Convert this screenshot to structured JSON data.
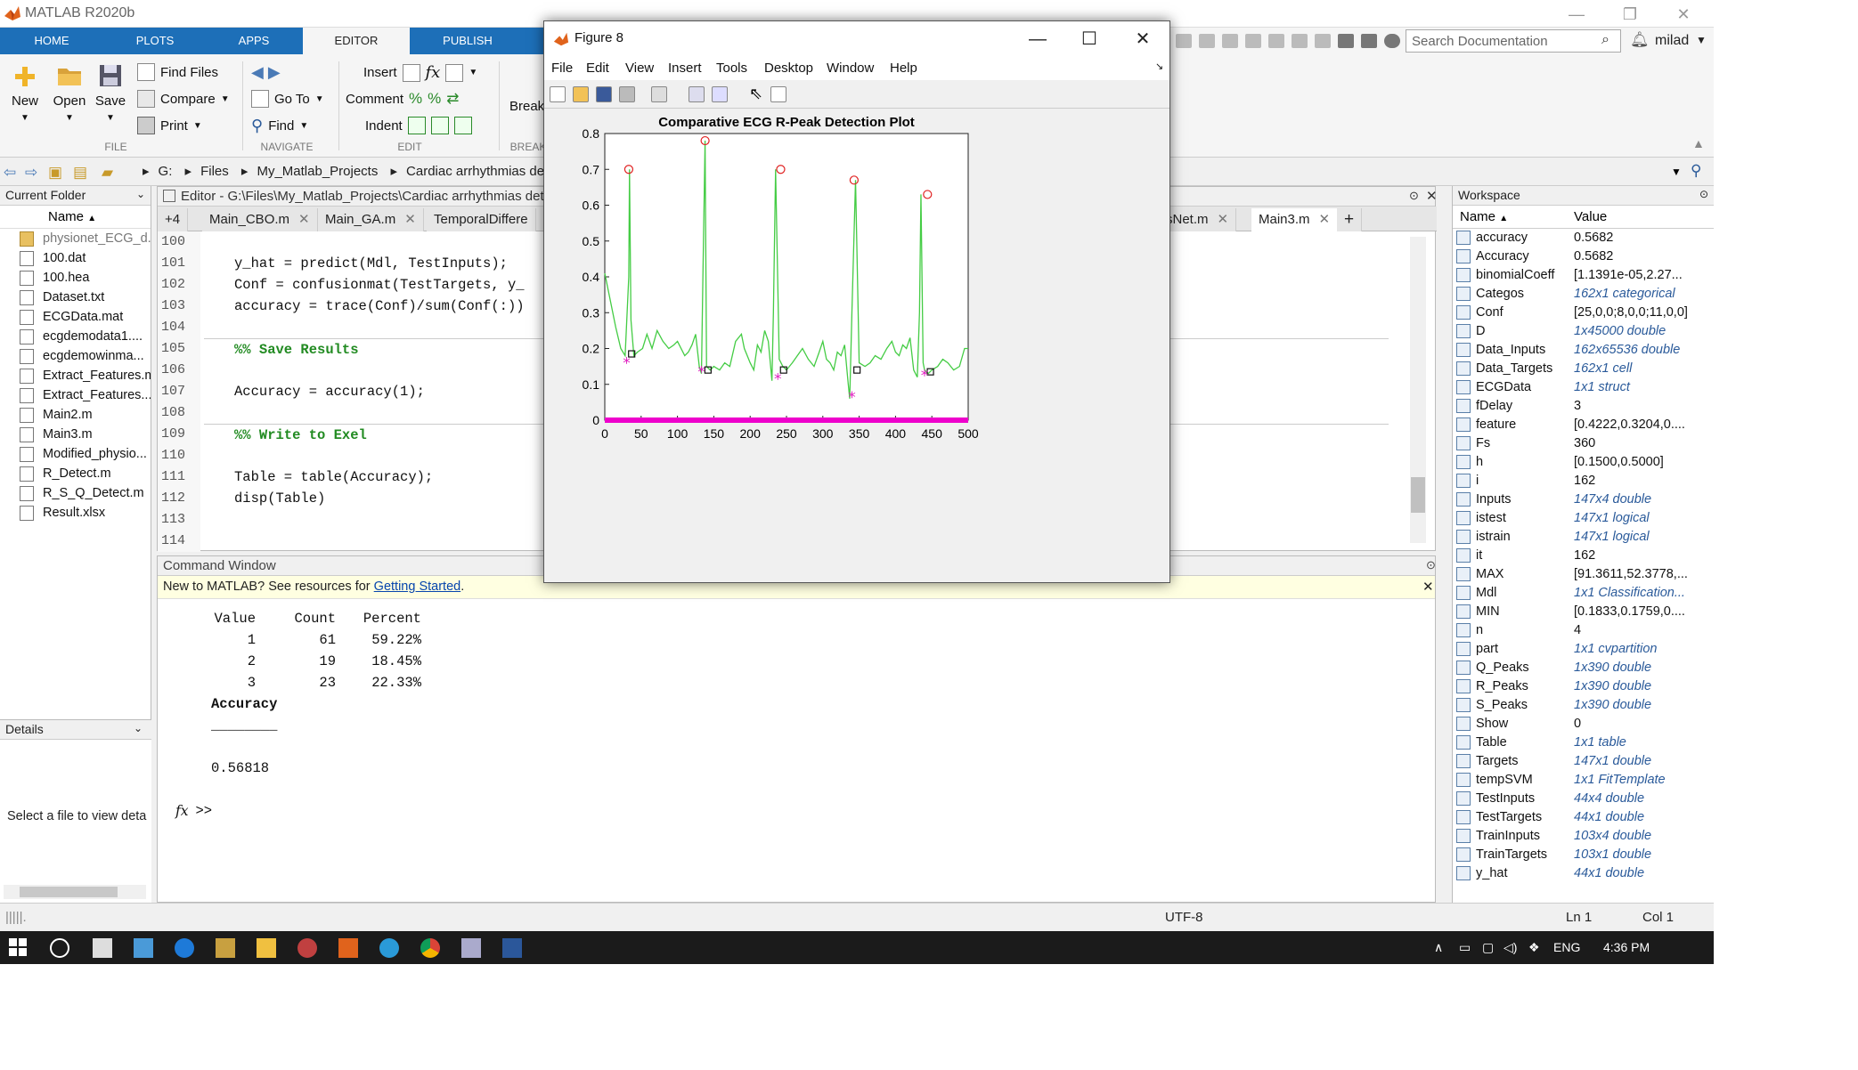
{
  "app": {
    "title": "MATLAB R2020b",
    "window_controls": [
      "—",
      "❐",
      "✕"
    ]
  },
  "tabs": [
    {
      "label": "HOME",
      "active": false
    },
    {
      "label": "PLOTS",
      "active": false
    },
    {
      "label": "APPS",
      "active": false
    },
    {
      "label": "EDITOR",
      "active": true
    },
    {
      "label": "PUBLISH",
      "active": false
    }
  ],
  "ribbon": {
    "file": {
      "new": "New",
      "open": "Open",
      "save": "Save",
      "find_files": "Find Files",
      "compare": "Compare",
      "print": "Print",
      "group": "FILE"
    },
    "navigate": {
      "go_to": "Go To",
      "find": "Find",
      "group": "NAVIGATE"
    },
    "edit": {
      "insert": "Insert",
      "comment": "Comment",
      "indent": "Indent",
      "group": "EDIT"
    },
    "breakpoints": {
      "label": "Break",
      "group": "BREAK"
    },
    "search_placeholder": "Search Documentation",
    "user": "milad"
  },
  "address": {
    "drive": "G:",
    "path": [
      "Files",
      "My_Matlab_Projects",
      "Cardiac arrhythmias detection"
    ]
  },
  "current_folder": {
    "header": "Current Folder",
    "column": "Name",
    "files": [
      "physionet_ECG_d...",
      "100.dat",
      "100.hea",
      "Dataset.txt",
      "ECGData.mat",
      "ecgdemodata1....",
      "ecgdemowinma...",
      "Extract_Features.m",
      "Extract_Features...",
      "Main2.m",
      "Main3.m",
      "Modified_physio...",
      "R_Detect.m",
      "R_S_Q_Detect.m",
      "Result.xlsx"
    ]
  },
  "details": {
    "header": "Details",
    "text": "Select a file to view deta"
  },
  "editor": {
    "header": "Editor - G:\\Files\\My_Matlab_Projects\\Cardiac arrhythmias dete",
    "tabs": [
      "+4",
      "Main_CBO.m",
      "Main_GA.m",
      "TemporalDiffere",
      "sNet.m",
      "Main3.m",
      "+"
    ],
    "line_numbers": [
      "100",
      "101",
      "102",
      "103",
      "104",
      "105",
      "106",
      "107",
      "108",
      "109",
      "110",
      "111",
      "112",
      "113",
      "114"
    ],
    "lines": [
      "",
      "y_hat = predict(Mdl, TestInputs);",
      "Conf = confusionmat(TestTargets, y_",
      "accuracy = trace(Conf)/sum(Conf(:))",
      "",
      "%% Save Results",
      "",
      "Accuracy = accuracy(1);",
      "",
      "%% Write to Exel",
      "",
      "Table = table(Accuracy);",
      "disp(Table)",
      "",
      ""
    ]
  },
  "command_window": {
    "header": "Command Window",
    "banner_text": "New to MATLAB? See resources for ",
    "banner_link": "Getting Started",
    "banner_end": ".",
    "table_header": [
      "Value",
      "Count",
      "Percent"
    ],
    "table_rows": [
      [
        "1",
        "61",
        "59.22%"
      ],
      [
        "2",
        "19",
        "18.45%"
      ],
      [
        "3",
        "23",
        "22.33%"
      ]
    ],
    "var_name": "Accuracy",
    "underline": "________",
    "var_value": "0.56818",
    "prompt": ">>"
  },
  "workspace": {
    "header": "Workspace",
    "columns": [
      "Name",
      "Value"
    ],
    "vars": [
      {
        "name": "accuracy",
        "value": "0.5682",
        "italic": false
      },
      {
        "name": "Accuracy",
        "value": "0.5682",
        "italic": false
      },
      {
        "name": "binomialCoeff",
        "value": "[1.1391e-05,2.27...",
        "italic": false
      },
      {
        "name": "Categos",
        "value": "162x1 categorical",
        "italic": true
      },
      {
        "name": "Conf",
        "value": "[25,0,0;8,0,0;11,0,0]",
        "italic": false
      },
      {
        "name": "D",
        "value": "1x45000 double",
        "italic": true
      },
      {
        "name": "Data_Inputs",
        "value": "162x65536 double",
        "italic": true
      },
      {
        "name": "Data_Targets",
        "value": "162x1 cell",
        "italic": true
      },
      {
        "name": "ECGData",
        "value": "1x1 struct",
        "italic": true
      },
      {
        "name": "fDelay",
        "value": "3",
        "italic": false
      },
      {
        "name": "feature",
        "value": "[0.4222,0.3204,0....",
        "italic": false
      },
      {
        "name": "Fs",
        "value": "360",
        "italic": false
      },
      {
        "name": "h",
        "value": "[0.1500,0.5000]",
        "italic": false
      },
      {
        "name": "i",
        "value": "162",
        "italic": false
      },
      {
        "name": "Inputs",
        "value": "147x4 double",
        "italic": true
      },
      {
        "name": "istest",
        "value": "147x1 logical",
        "italic": true
      },
      {
        "name": "istrain",
        "value": "147x1 logical",
        "italic": true
      },
      {
        "name": "it",
        "value": "162",
        "italic": false
      },
      {
        "name": "MAX",
        "value": "[91.3611,52.3778,...",
        "italic": false
      },
      {
        "name": "Mdl",
        "value": "1x1 Classification...",
        "italic": true
      },
      {
        "name": "MIN",
        "value": "[0.1833,0.1759,0....",
        "italic": false
      },
      {
        "name": "n",
        "value": "4",
        "italic": false
      },
      {
        "name": "part",
        "value": "1x1 cvpartition",
        "italic": true
      },
      {
        "name": "Q_Peaks",
        "value": "1x390 double",
        "italic": true
      },
      {
        "name": "R_Peaks",
        "value": "1x390 double",
        "italic": true
      },
      {
        "name": "S_Peaks",
        "value": "1x390 double",
        "italic": true
      },
      {
        "name": "Show",
        "value": "0",
        "italic": false
      },
      {
        "name": "Table",
        "value": "1x1 table",
        "italic": true
      },
      {
        "name": "Targets",
        "value": "147x1 double",
        "italic": true
      },
      {
        "name": "tempSVM",
        "value": "1x1 FitTemplate",
        "italic": true
      },
      {
        "name": "TestInputs",
        "value": "44x4 double",
        "italic": true
      },
      {
        "name": "TestTargets",
        "value": "44x1 double",
        "italic": true
      },
      {
        "name": "TrainInputs",
        "value": "103x4 double",
        "italic": true
      },
      {
        "name": "TrainTargets",
        "value": "103x1 double",
        "italic": true
      },
      {
        "name": "y_hat",
        "value": "44x1 double",
        "italic": true
      }
    ]
  },
  "statusbar": {
    "encoding": "UTF-8",
    "ln": "Ln  1",
    "col": "Col  1"
  },
  "taskbar": {
    "lang": "ENG",
    "time": "4:36 PM"
  },
  "figure": {
    "title": "Figure 8",
    "menu": [
      "File",
      "Edit",
      "View",
      "Insert",
      "Tools",
      "Desktop",
      "Window",
      "Help"
    ]
  },
  "chart_data": {
    "type": "line",
    "title": "Comparative ECG R-Peak Detection Plot",
    "xlabel": "",
    "ylabel": "",
    "xlim": [
      0,
      500
    ],
    "ylim": [
      0,
      0.8
    ],
    "xticks": [
      0,
      50,
      100,
      150,
      200,
      250,
      300,
      350,
      400,
      450,
      500
    ],
    "yticks": [
      0,
      0.1,
      0.2,
      0.3,
      0.4,
      0.5,
      0.6,
      0.7,
      0.8
    ],
    "signal": {
      "color": "#44cc44",
      "x": [
        0,
        8,
        15,
        22,
        28,
        33,
        34,
        36,
        40,
        45,
        52,
        58,
        65,
        72,
        80,
        88,
        95,
        100,
        105,
        110,
        115,
        120,
        125,
        130,
        133,
        135,
        138,
        140,
        145,
        150,
        158,
        165,
        172,
        180,
        188,
        192,
        196,
        200,
        205,
        210,
        215,
        220,
        225,
        230,
        232,
        235,
        240,
        245,
        250,
        258,
        265,
        272,
        280,
        288,
        295,
        300,
        305,
        310,
        315,
        320,
        325,
        330,
        335,
        337,
        340,
        345,
        350,
        358,
        365,
        372,
        380,
        388,
        395,
        400,
        405,
        410,
        415,
        420,
        425,
        430,
        433,
        435,
        438,
        440,
        445,
        450,
        458,
        465,
        472,
        480,
        488,
        495,
        500
      ],
      "y": [
        0.41,
        0.33,
        0.26,
        0.2,
        0.18,
        0.4,
        0.7,
        0.28,
        0.18,
        0.19,
        0.2,
        0.24,
        0.2,
        0.25,
        0.22,
        0.2,
        0.21,
        0.22,
        0.2,
        0.18,
        0.19,
        0.21,
        0.24,
        0.15,
        0.13,
        0.4,
        0.78,
        0.15,
        0.14,
        0.15,
        0.14,
        0.16,
        0.15,
        0.22,
        0.24,
        0.2,
        0.18,
        0.16,
        0.14,
        0.21,
        0.19,
        0.25,
        0.22,
        0.11,
        0.3,
        0.7,
        0.17,
        0.15,
        0.14,
        0.16,
        0.18,
        0.2,
        0.17,
        0.15,
        0.19,
        0.22,
        0.17,
        0.16,
        0.14,
        0.19,
        0.18,
        0.21,
        0.1,
        0.06,
        0.3,
        0.67,
        0.16,
        0.15,
        0.16,
        0.18,
        0.17,
        0.2,
        0.22,
        0.19,
        0.18,
        0.21,
        0.2,
        0.23,
        0.14,
        0.12,
        0.3,
        0.63,
        0.16,
        0.14,
        0.13,
        0.14,
        0.15,
        0.17,
        0.16,
        0.14,
        0.15,
        0.2,
        0.2
      ]
    },
    "r_peaks": {
      "color": "#e02020",
      "x": [
        33,
        138,
        242,
        343,
        444
      ],
      "y": [
        0.7,
        0.78,
        0.7,
        0.67,
        0.63
      ]
    },
    "s_peaks": {
      "color": "#111111",
      "x": [
        37,
        142,
        246,
        347,
        448
      ],
      "y": [
        0.185,
        0.14,
        0.14,
        0.14,
        0.135
      ]
    },
    "q_peaks": {
      "color": "#e020c0",
      "x": [
        30,
        133,
        238,
        340,
        440
      ],
      "y": [
        0.16,
        0.135,
        0.115,
        0.065,
        0.125
      ]
    },
    "baseline_color": "#ee00cc"
  }
}
